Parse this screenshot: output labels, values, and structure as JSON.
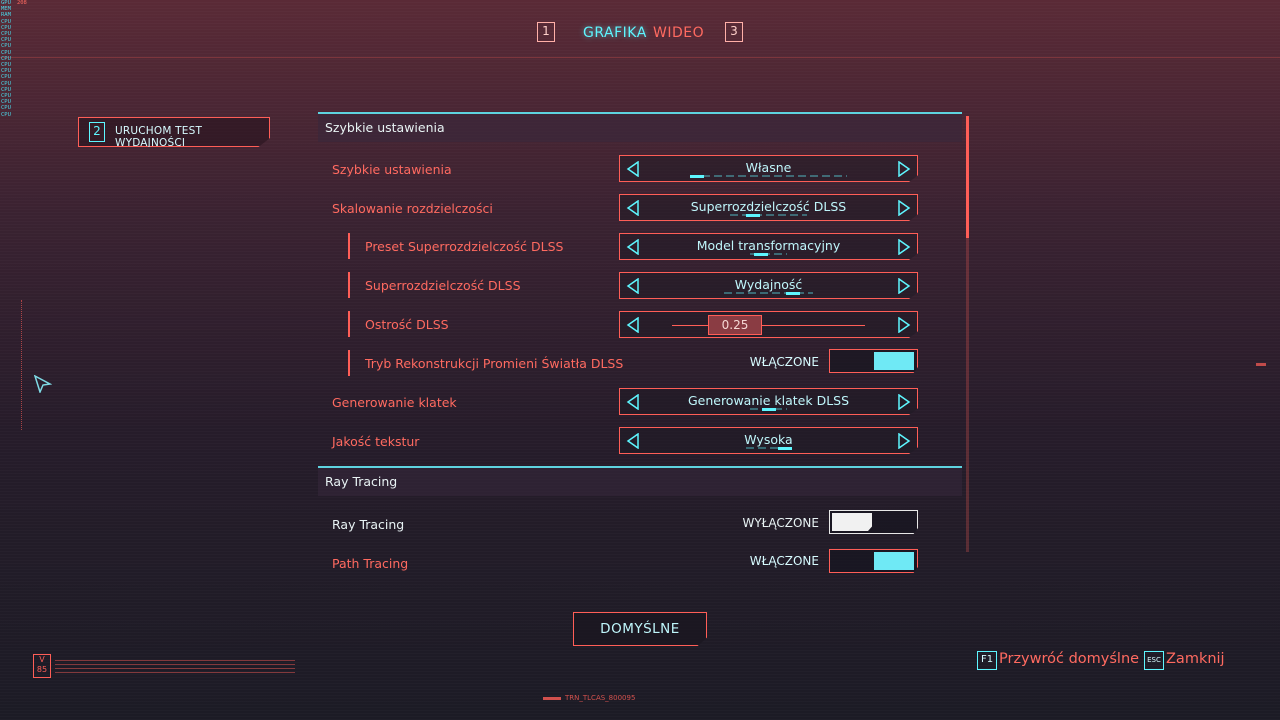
{
  "tabs": {
    "left_key": "1",
    "active": "GRAFIKA",
    "inactive": "WIDEO",
    "right_key": "3"
  },
  "benchmark": {
    "key": "2",
    "label": "URUCHOM TEST WYDAJNOŚCI"
  },
  "hud": {
    "lines": [
      {
        "k": "GPU",
        "v": "208"
      },
      {
        "k": "MEM",
        "v": ""
      },
      {
        "k": "RAM",
        "v": ""
      },
      {
        "k": "CPU",
        "v": ""
      },
      {
        "k": "CPU",
        "v": ""
      },
      {
        "k": "CPU",
        "v": ""
      },
      {
        "k": "CPU",
        "v": ""
      },
      {
        "k": "CPU",
        "v": ""
      },
      {
        "k": "CPU",
        "v": ""
      },
      {
        "k": "CPU",
        "v": ""
      },
      {
        "k": "CPU",
        "v": ""
      },
      {
        "k": "CPU",
        "v": ""
      },
      {
        "k": "CPU",
        "v": ""
      },
      {
        "k": "CPU",
        "v": ""
      },
      {
        "k": "CPU",
        "v": ""
      },
      {
        "k": "CPU",
        "v": ""
      },
      {
        "k": "CPU",
        "v": ""
      },
      {
        "k": "CPU",
        "v": ""
      },
      {
        "k": "CPU",
        "v": ""
      }
    ]
  },
  "sections": {
    "quick": {
      "title": "Szybkie ustawienia",
      "rows": {
        "preset": {
          "label": "Szybkie ustawienia",
          "value": "Własne"
        },
        "scaling": {
          "label": "Skalowanie rozdzielczości",
          "value": "Superrozdzielczość DLSS"
        },
        "dlss_preset": {
          "label": "Preset Superrozdzielczość DLSS",
          "value": "Model transformacyjny"
        },
        "dlss_sr": {
          "label": "Superrozdzielczość DLSS",
          "value": "Wydajność"
        },
        "dlss_sharpness": {
          "label": "Ostrość DLSS",
          "value": "0.25",
          "level": 0.25
        },
        "ray_reconstruction": {
          "label": "Tryb Rekonstrukcji Promieni Światła DLSS",
          "state": "WŁĄCZONE"
        },
        "frame_gen": {
          "label": "Generowanie klatek",
          "value": "Generowanie klatek DLSS"
        },
        "texture": {
          "label": "Jakość tekstur",
          "value": "Wysoka"
        }
      }
    },
    "rt": {
      "title": "Ray Tracing",
      "rows": {
        "ray_tracing": {
          "label": "Ray Tracing",
          "state": "WYŁĄCZONE"
        },
        "path_tracing": {
          "label": "Path Tracing",
          "state": "WŁĄCZONE"
        }
      }
    }
  },
  "footer": {
    "defaults": "DOMYŚLNE",
    "restore_key": "F1",
    "restore_label": "Przywróć domyślne",
    "close_key": "ESC",
    "close_label": "Zamknij",
    "badge": "V 85",
    "trn": "TRN_TLCAS_800095"
  },
  "colors": {
    "accent_red": "#ff5e57",
    "accent_cyan": "#5ef6ff"
  }
}
